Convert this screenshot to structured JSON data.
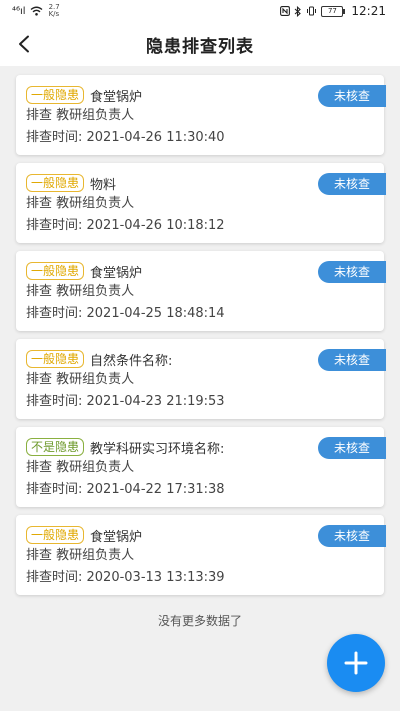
{
  "status_bar": {
    "signal_left": "⁴⁶ıl",
    "speed_top": "2.7",
    "speed_bottom": "K/s",
    "battery": "77",
    "time": "12:21"
  },
  "header": {
    "title": "隐患排查列表"
  },
  "colors": {
    "pill": "#3d8fd9",
    "fab": "#1a8cf2",
    "tag_general": "#e0a800",
    "tag_not": "#6e9a2c"
  },
  "items": [
    {
      "tag": "一般隐患",
      "tag_type": "general",
      "title": "食堂锅炉",
      "line2": "排查 教研组负责人",
      "line3": "排查时间: 2021-04-26 11:30:40",
      "status": "未核查"
    },
    {
      "tag": "一般隐患",
      "tag_type": "general",
      "title": "物料",
      "line2": "排查 教研组负责人",
      "line3": "排查时间: 2021-04-26 10:18:12",
      "status": "未核查"
    },
    {
      "tag": "一般隐患",
      "tag_type": "general",
      "title": "食堂锅炉",
      "line2": "排查 教研组负责人",
      "line3": "排查时间: 2021-04-25 18:48:14",
      "status": "未核查"
    },
    {
      "tag": "一般隐患",
      "tag_type": "general",
      "title": "自然条件名称:",
      "line2": "排查 教研组负责人",
      "line3": "排查时间: 2021-04-23 21:19:53",
      "status": "未核查"
    },
    {
      "tag": "不是隐患",
      "tag_type": "not",
      "title": "教学科研实习环境名称:",
      "line2": "排查 教研组负责人",
      "line3": "排查时间: 2021-04-22 17:31:38",
      "status": "未核查"
    },
    {
      "tag": "一般隐患",
      "tag_type": "general",
      "title": "食堂锅炉",
      "line2": "排查 教研组负责人",
      "line3": "排查时间: 2020-03-13 13:13:39",
      "status": "未核查"
    }
  ],
  "footer": {
    "no_more": "没有更多数据了"
  }
}
